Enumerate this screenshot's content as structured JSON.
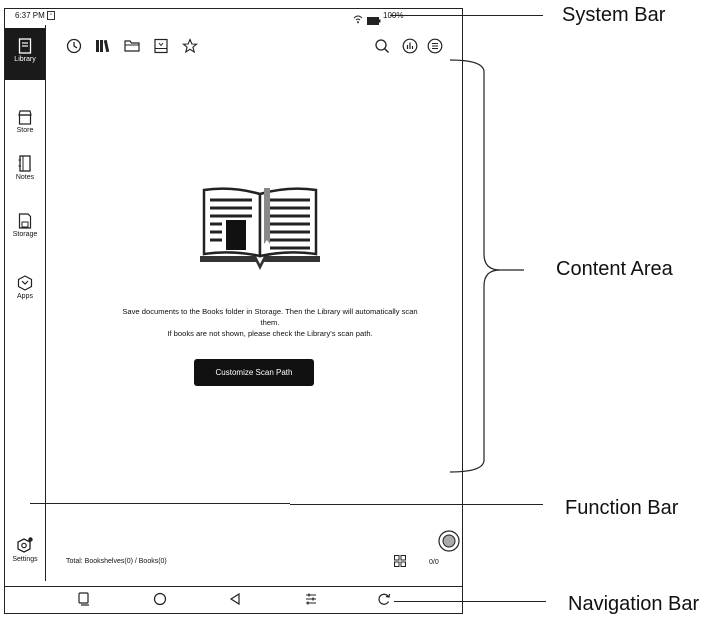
{
  "status_bar": {
    "time": "6:37 PM",
    "battery": "100%"
  },
  "sidebar": {
    "items": [
      {
        "label": "Library",
        "icon": "library-icon",
        "active": true
      },
      {
        "label": "Store",
        "icon": "store-icon"
      },
      {
        "label": "Notes",
        "icon": "notes-icon"
      },
      {
        "label": "Storage",
        "icon": "storage-icon"
      },
      {
        "label": "Apps",
        "icon": "apps-icon"
      }
    ],
    "settings_label": "Settings"
  },
  "toolbar": {
    "left_icons": [
      "recent-clock-icon",
      "bookshelf-icon",
      "folder-icon",
      "storage-drive-icon",
      "favorites-star-icon"
    ],
    "right_icons": [
      "search-icon",
      "stats-icon",
      "menu-icon"
    ]
  },
  "empty_state": {
    "line1": "Save documents to the Books folder in Storage. Then the Library will automatically scan",
    "line2": "them.",
    "line3": "If books are not shown, please check the Library's scan path.",
    "button_label": "Customize Scan Path"
  },
  "footer": {
    "total_text": "Total: Bookshelves(0) / Books(0)",
    "page_count": "0/0"
  },
  "nav_bar": {
    "icons": [
      "recent-apps-icon",
      "home-icon",
      "back-icon",
      "settings-sliders-icon",
      "refresh-icon"
    ]
  },
  "callouts": {
    "system_bar": "System Bar",
    "content_area": "Content Area",
    "function_bar": "Function Bar",
    "navigation_bar": "Navigation Bar"
  }
}
